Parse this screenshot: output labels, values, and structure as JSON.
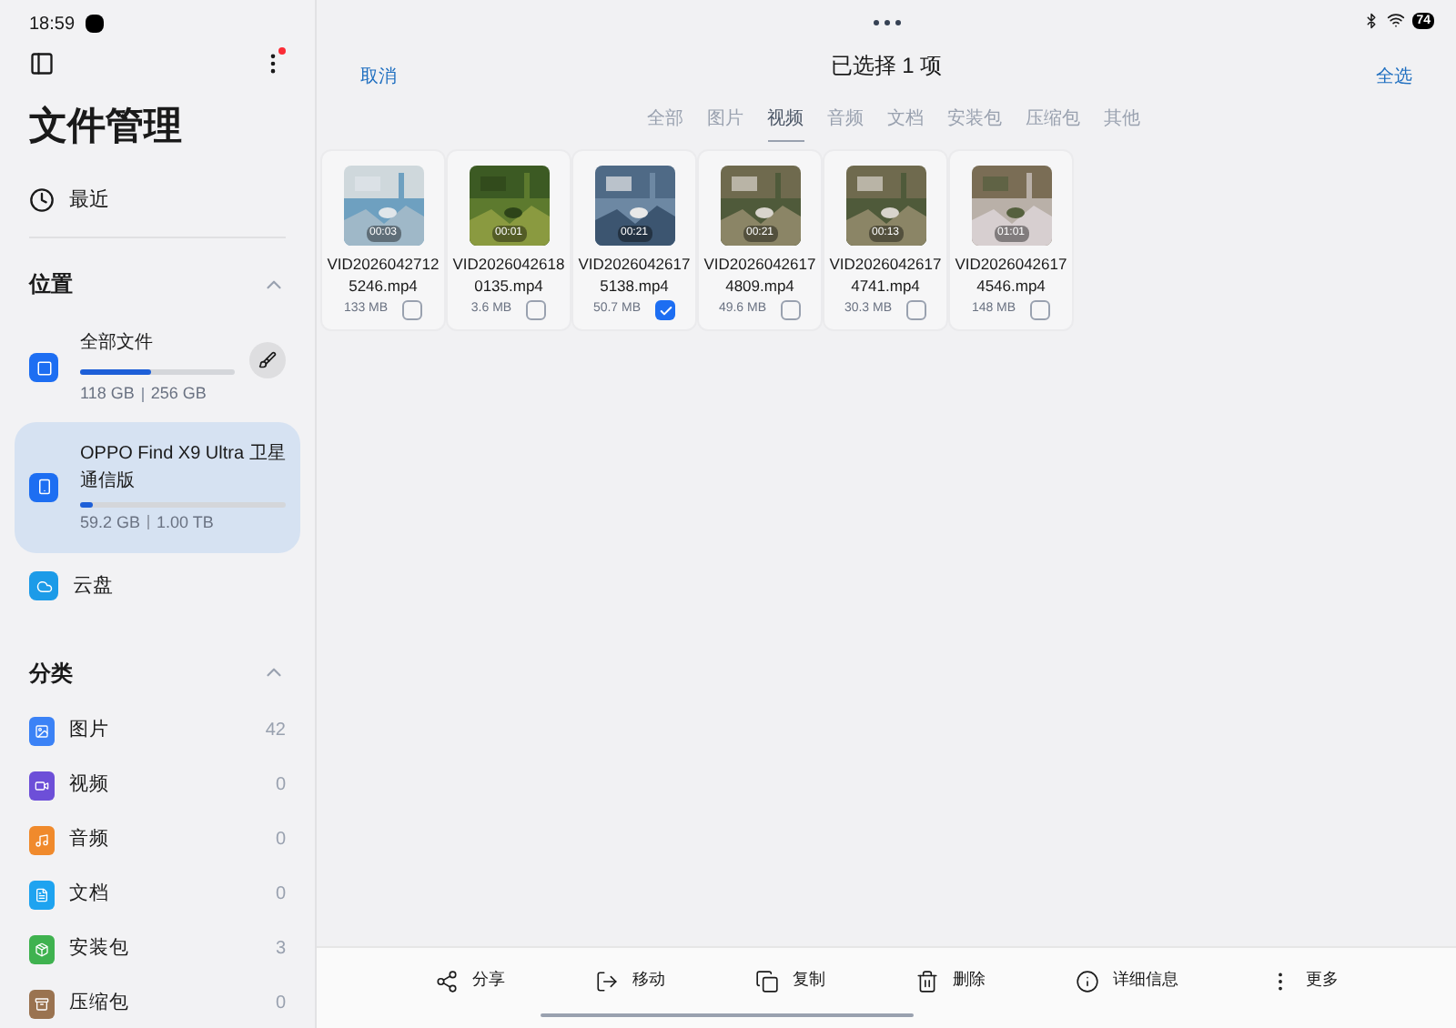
{
  "status_bar": {
    "time": "18:59",
    "battery": "74"
  },
  "sidebar": {
    "title": "文件管理",
    "recent": "最近",
    "locations": {
      "heading": "位置",
      "expanded": true,
      "items": [
        {
          "kind": "storage",
          "name": "全部文件",
          "usage": "118 GB",
          "capacity": "256 GB",
          "level": 0.46,
          "selected": false,
          "cleanup": true
        },
        {
          "kind": "storage",
          "name": "OPPO Find X9 Ultra 卫星通信版",
          "usage": "59.2 GB",
          "capacity": "1.00 TB",
          "level": 0.06,
          "selected": true,
          "cleanup": false
        },
        {
          "kind": "cloud",
          "name": "云盘",
          "selected": false
        }
      ]
    },
    "categories": {
      "heading": "分类",
      "expanded": true,
      "items": [
        {
          "name": "图片",
          "count": "42",
          "color": "#3b82f6"
        },
        {
          "name": "视频",
          "count": "0",
          "color": "#6d4fd8"
        },
        {
          "name": "音频",
          "count": "0",
          "color": "#f08a2c"
        },
        {
          "name": "文档",
          "count": "0",
          "color": "#1ea3f0"
        },
        {
          "name": "安装包",
          "count": "3",
          "color": "#3fb24f"
        },
        {
          "name": "压缩包",
          "count": "0",
          "color": "#9a7350"
        }
      ]
    }
  },
  "header": {
    "cancel": "取消",
    "title": "已选择 1 项",
    "select_all": "全选"
  },
  "tabs": [
    {
      "label": "全部",
      "selected": false
    },
    {
      "label": "图片",
      "selected": false
    },
    {
      "label": "视频",
      "selected": true
    },
    {
      "label": "音频",
      "selected": false
    },
    {
      "label": "文档",
      "selected": false
    },
    {
      "label": "安装包",
      "selected": false
    },
    {
      "label": "压缩包",
      "selected": false
    },
    {
      "label": "其他",
      "selected": false
    }
  ],
  "files": [
    {
      "name": "VID20260427125246.mp4",
      "duration": "00:03",
      "size": "133 MB",
      "checked": false
    },
    {
      "name": "VID20260426180135.mp4",
      "duration": "00:01",
      "size": "3.6 MB",
      "checked": false
    },
    {
      "name": "VID20260426175138.mp4",
      "duration": "00:21",
      "size": "50.7 MB",
      "checked": true
    },
    {
      "name": "VID20260426174809.mp4",
      "duration": "00:21",
      "size": "49.6 MB",
      "checked": false
    },
    {
      "name": "VID20260426174741.mp4",
      "duration": "00:13",
      "size": "30.3 MB",
      "checked": false
    },
    {
      "name": "VID20260426174546.mp4",
      "duration": "01:01",
      "size": "148 MB",
      "checked": false
    }
  ],
  "actions": [
    {
      "label": "分享"
    },
    {
      "label": "移动"
    },
    {
      "label": "复制"
    },
    {
      "label": "删除"
    },
    {
      "label": "详细信息"
    },
    {
      "label": "更多"
    }
  ]
}
